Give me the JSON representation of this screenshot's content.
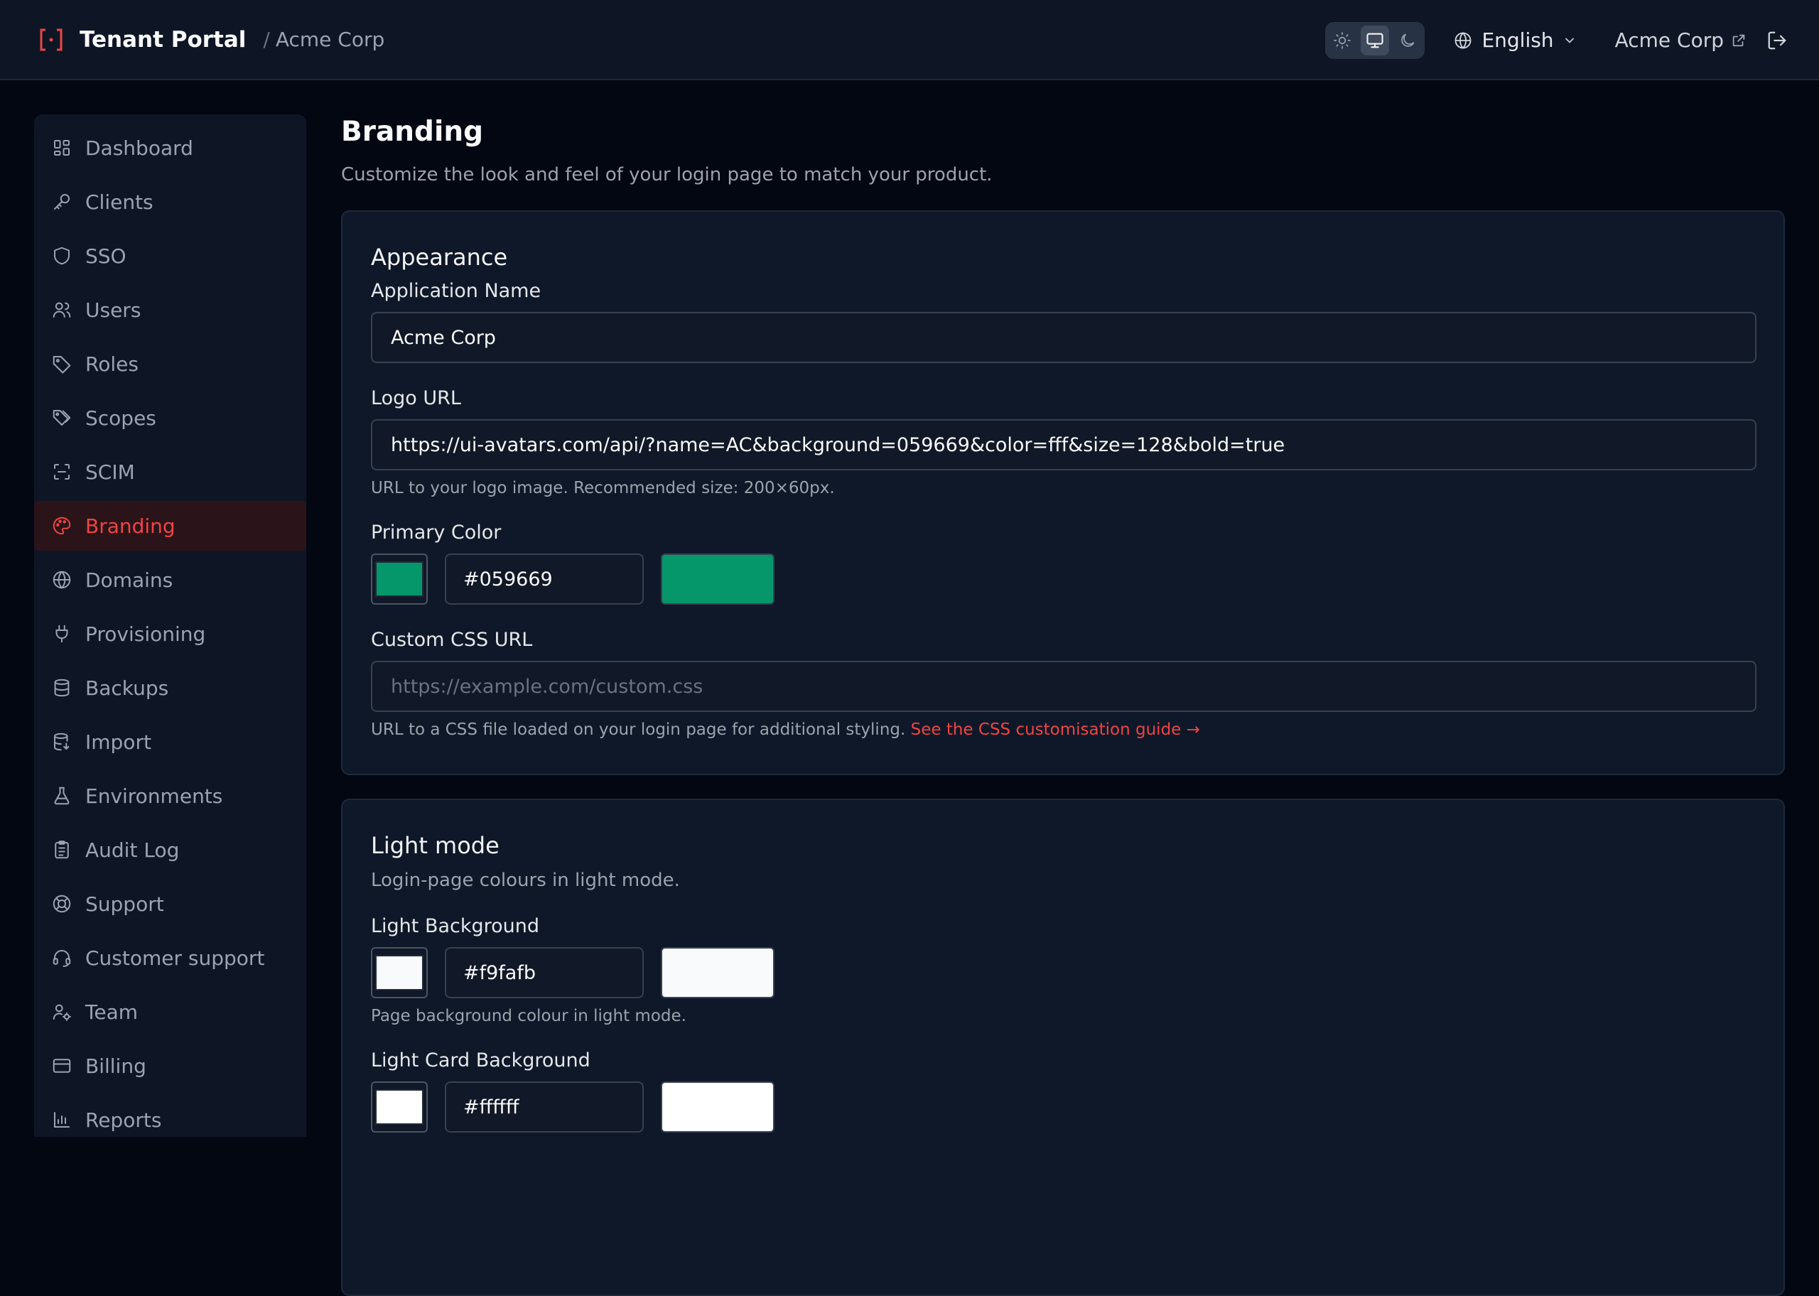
{
  "header": {
    "title": "Tenant Portal",
    "separator": "/",
    "tenant": "Acme Corp",
    "language": "English",
    "tenant_link": "Acme Corp"
  },
  "sidebar": {
    "items": [
      {
        "label": "Dashboard",
        "icon": "dashboard-icon"
      },
      {
        "label": "Clients",
        "icon": "key-icon"
      },
      {
        "label": "SSO",
        "icon": "shield-icon"
      },
      {
        "label": "Users",
        "icon": "users-icon"
      },
      {
        "label": "Roles",
        "icon": "tag-icon"
      },
      {
        "label": "Scopes",
        "icon": "tags-icon"
      },
      {
        "label": "SCIM",
        "icon": "scan-icon"
      },
      {
        "label": "Branding",
        "icon": "palette-icon",
        "active": true
      },
      {
        "label": "Domains",
        "icon": "globe-icon"
      },
      {
        "label": "Provisioning",
        "icon": "plug-icon"
      },
      {
        "label": "Backups",
        "icon": "database-icon"
      },
      {
        "label": "Import",
        "icon": "database-import-icon"
      },
      {
        "label": "Environments",
        "icon": "flask-icon"
      },
      {
        "label": "Audit Log",
        "icon": "clipboard-icon"
      },
      {
        "label": "Support",
        "icon": "lifebuoy-icon"
      },
      {
        "label": "Customer support",
        "icon": "headset-icon"
      },
      {
        "label": "Team",
        "icon": "user-gear-icon"
      },
      {
        "label": "Billing",
        "icon": "credit-card-icon"
      },
      {
        "label": "Reports",
        "icon": "bar-chart-icon"
      }
    ]
  },
  "page": {
    "title": "Branding",
    "subtitle": "Customize the look and feel of your login page to match your product."
  },
  "appearance": {
    "title": "Appearance",
    "app_name_label": "Application Name",
    "app_name_value": "Acme Corp",
    "logo_label": "Logo URL",
    "logo_value": "https://ui-avatars.com/api/?name=AC&background=059669&color=fff&size=128&bold=true",
    "logo_hint": "URL to your logo image. Recommended size: 200×60px.",
    "primary_label": "Primary Color",
    "primary_value": "#059669",
    "css_label": "Custom CSS URL",
    "css_placeholder": "https://example.com/custom.css",
    "css_hint": "URL to a CSS file loaded on your login page for additional styling.",
    "css_link": "See the CSS customisation guide →"
  },
  "light_mode": {
    "title": "Light mode",
    "description": "Login-page colours in light mode.",
    "bg_label": "Light Background",
    "bg_value": "#f9fafb",
    "bg_hint": "Page background colour in light mode.",
    "card_label": "Light Card Background",
    "card_value": "#ffffff"
  },
  "colors": {
    "accent": "#ef4444",
    "primary": "#059669",
    "light_bg": "#f9fafb",
    "light_card": "#ffffff"
  }
}
